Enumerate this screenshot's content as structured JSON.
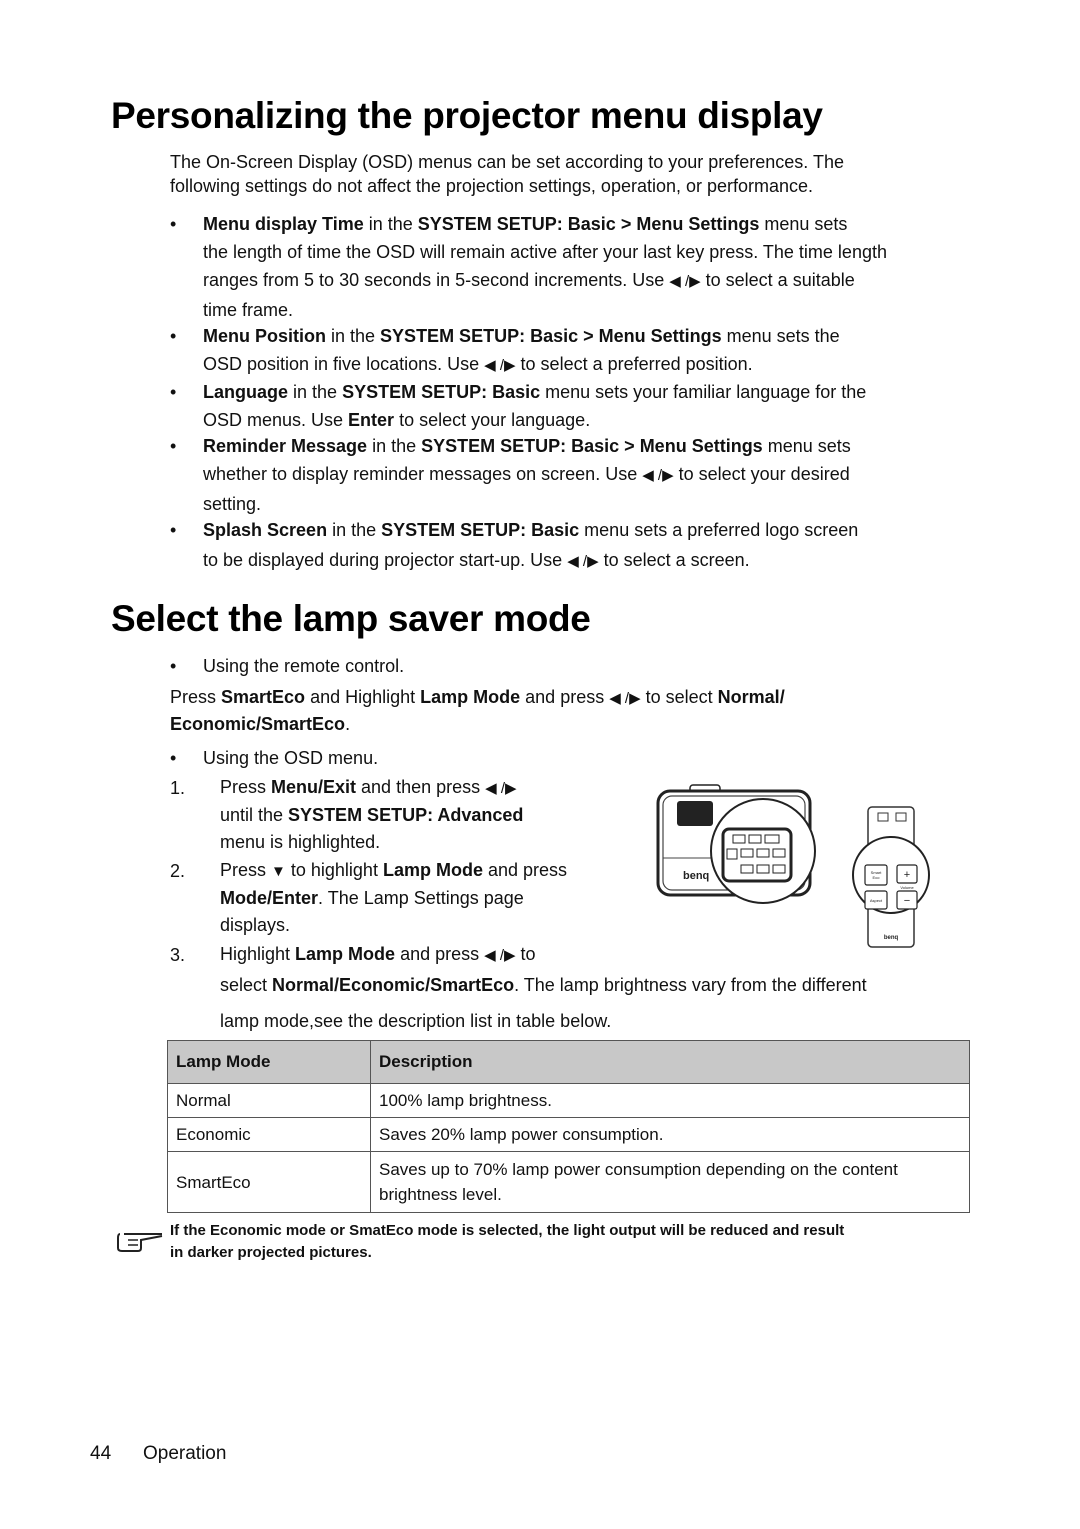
{
  "section1": {
    "title": "Personalizing the projector menu display",
    "intro_line1": "The On-Screen Display (OSD) menus can be set according to your preferences. The",
    "intro_line2": "following settings do not affect the projection settings, operation, or performance.",
    "bullets": [
      {
        "term": "Menu display Time",
        "in_the": " in the ",
        "path": "SYSTEM SETUP: Basic > Menu Settings",
        "line1_rest": " menu sets",
        "line2": "the length of time the OSD will remain active after your last key press. The time length",
        "line3_a": "ranges from 5 to 30 seconds in 5-second increments. Use ",
        "line3_b": " to select a suitable",
        "line4": "time frame."
      },
      {
        "term": "Menu Position",
        "in_the": " in the ",
        "path": "SYSTEM SETUP: Basic > Menu Settings",
        "line1_rest": " menu sets the",
        "line2_a": "OSD position in five locations. Use ",
        "line2_b": " to select a preferred position."
      },
      {
        "term": "Language",
        "in_the": " in the ",
        "path": "SYSTEM SETUP: Basic",
        "line1_rest": " menu sets your familiar language for the",
        "line2_a": "OSD menus. Use ",
        "line2_key": "Enter",
        "line2_b": " to select your language."
      },
      {
        "term": "Reminder Message",
        "in_the": " in the ",
        "path": "SYSTEM SETUP: Basic > Menu Settings",
        "line1_rest": " menu sets",
        "line2_a": "whether to display reminder messages on screen. Use ",
        "line2_b": " to select your desired",
        "line3": "setting."
      },
      {
        "term": "Splash Screen",
        "in_the": " in the ",
        "path": "SYSTEM SETUP: Basic",
        "line1_rest": " menu sets a preferred logo screen",
        "line2_a": "to be displayed during projector start-up. Use ",
        "line2_b": " to select a screen."
      }
    ]
  },
  "section2": {
    "title": "Select the lamp saver mode",
    "remote_bullet": "Using the remote control.",
    "remote_text": {
      "a": "Press ",
      "key1": "SmartEco",
      "b": " and Highlight ",
      "key2": "Lamp Mode",
      "c": " and press ",
      "d": " to select ",
      "key3": "Normal/",
      "key4": "Economic/SmartEco",
      "e": "."
    },
    "osd_bullet": "Using the OSD menu.",
    "steps": [
      {
        "num": "1.",
        "a": "Press ",
        "key1": "Menu/Exit",
        "b": " and then press ",
        "line2_a": "until the ",
        "key2": "SYSTEM SETUP: Advanced",
        "line3": "menu is highlighted."
      },
      {
        "num": "2.",
        "a": "Press ",
        "b": " to highlight ",
        "key1": "Lamp Mode",
        "c": " and press",
        "key2": "Mode/Enter",
        "line2_rest": ". The Lamp Settings page",
        "line3": "displays."
      },
      {
        "num": "3.",
        "a": "Highlight ",
        "key1": "Lamp Mode",
        "b": " and press ",
        "c": " to",
        "line2_a": "select ",
        "key2": "Normal/Economic/SmartEco",
        "line2_b": ".  The lamp brightness vary from the different",
        "line3": "lamp mode,see the description list in table below."
      }
    ],
    "arrows": {
      "left_right": "◀ /▶",
      "down": "▼"
    },
    "illustration": {
      "projector_brand": "benq",
      "remote_brand": "benq",
      "remote_labels": [
        "Smart Eco",
        "+",
        "Volume",
        "Aspect",
        "−"
      ]
    },
    "table": {
      "headers": [
        "Lamp Mode",
        "Description"
      ],
      "rows": [
        [
          "Normal",
          "100% lamp brightness."
        ],
        [
          "Economic",
          "Saves 20% lamp power consumption."
        ],
        [
          "SmartEco",
          "Saves up to 70% lamp power consumption depending on the content brightness level."
        ]
      ]
    },
    "note_line1": "If the Economic mode or SmatEco mode is selected, the light output will be reduced and result",
    "note_line2": "in darker projected pictures."
  },
  "footer": {
    "page_number": "44",
    "section": "Operation"
  }
}
